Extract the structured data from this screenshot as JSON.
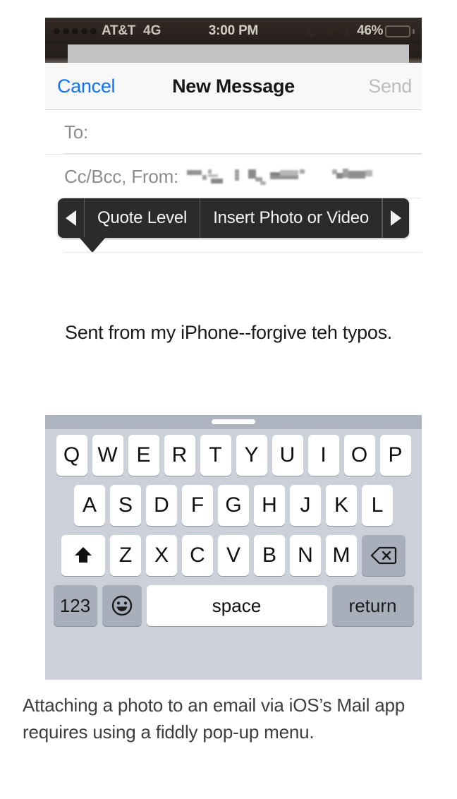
{
  "status_bar": {
    "signal_dots": 5,
    "carrier": "AT&T",
    "network": "4G",
    "time": "3:00 PM",
    "icons": [
      "moon-icon",
      "location-arrow-icon",
      "bluetooth-icon"
    ],
    "battery_percent": "46%",
    "battery_level": 46,
    "battery_color": "#f5c518"
  },
  "nav_bar": {
    "cancel_label": "Cancel",
    "title": "New Message",
    "send_label": "Send",
    "cancel_color": "#1072ff",
    "send_color": "#bcbcbc"
  },
  "compose": {
    "to_label": "To:",
    "to_value": "",
    "cc_bcc_from_label": "Cc/Bcc, From:",
    "from_value_redacted": true
  },
  "popup_menu": {
    "prev_arrow": "◀",
    "next_arrow": "▶",
    "items": [
      {
        "label": "Quote Level"
      },
      {
        "label": "Insert Photo or Video"
      }
    ],
    "background": "#2b2b2b"
  },
  "mail_body": {
    "signature": "Sent from my iPhone--forgive teh typos."
  },
  "keyboard": {
    "row1": [
      "Q",
      "W",
      "E",
      "R",
      "T",
      "Y",
      "U",
      "I",
      "O",
      "P"
    ],
    "row2": [
      "A",
      "S",
      "D",
      "F",
      "G",
      "H",
      "J",
      "K",
      "L"
    ],
    "row3": [
      "Z",
      "X",
      "C",
      "V",
      "B",
      "N",
      "M"
    ],
    "shift_key": "shift-icon",
    "delete_key": "delete-icon",
    "numbers_key": "123",
    "emoji_key": "😀",
    "space_key": "space",
    "return_key": "return",
    "background": "#ccd0d8"
  },
  "caption": {
    "text": "Attaching a photo to an email via iOS’s Mail app requires using a fiddly pop-up menu."
  }
}
